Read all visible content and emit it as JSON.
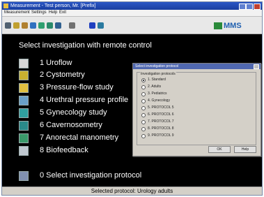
{
  "window": {
    "title": "Measurement - Test person, Mr. [Prefix]",
    "minimize_icon": "minimize-icon",
    "maximize_icon": "maximize-icon",
    "close_icon": "close-icon"
  },
  "menu": {
    "items": [
      "Measurement",
      "Settings",
      "Help",
      "Exit"
    ]
  },
  "toolbar": {
    "logo_text": "MMS",
    "buttons": [
      "run-icon",
      "tools-icon",
      "settings-icon",
      "graph-icon",
      "person-icon",
      "monitor-icon",
      "arrow-icon",
      "book-icon"
    ]
  },
  "main": {
    "heading": "Select investigation with remote control",
    "items": [
      {
        "label": "1 Uroflow",
        "icon": "uroflow-icon",
        "color": "#d8d8d8"
      },
      {
        "label": "2 Cystometry",
        "icon": "cystometry-icon",
        "color": "#c8b030"
      },
      {
        "label": "3 Pressure-flow study",
        "icon": "pressure-flow-icon",
        "color": "#e0c040"
      },
      {
        "label": "4 Urethral pressure profile",
        "icon": "urethral-pressure-icon",
        "color": "#6aa0c8"
      },
      {
        "label": "5 Gynecology study",
        "icon": "gynecology-icon",
        "color": "#30a0a0"
      },
      {
        "label": "6 Cavernosometry",
        "icon": "cavernosometry-icon",
        "color": "#2a8a8a"
      },
      {
        "label": "7 Anorectal manometry",
        "icon": "anorectal-icon",
        "color": "#3a9a6a"
      },
      {
        "label": "8 Biofeedback",
        "icon": "biofeedback-icon",
        "color": "#c0c8d0"
      }
    ],
    "protocol_item": {
      "label": "0 Select investigation protocol",
      "icon": "protocol-icon",
      "color": "#8090b0"
    }
  },
  "dialog": {
    "title": "Select investigation protocol",
    "group_label": "Investigation protocols",
    "options": [
      {
        "label": "1. Standard",
        "selected": true
      },
      {
        "label": "2. Adults",
        "selected": false
      },
      {
        "label": "3. Pediatrics",
        "selected": false
      },
      {
        "label": "4. Gynecology",
        "selected": false
      },
      {
        "label": "5. PROTOCOL 5",
        "selected": false
      },
      {
        "label": "6. PROTOCOL 6",
        "selected": false
      },
      {
        "label": "7. PROTOCOL 7",
        "selected": false
      },
      {
        "label": "8. PROTOCOL 8",
        "selected": false
      },
      {
        "label": "9. PROTOCOL 9",
        "selected": false
      }
    ],
    "ok_label": "OK",
    "help_label": "Help"
  },
  "status": {
    "text": "Selected protocol: Urology adults"
  }
}
